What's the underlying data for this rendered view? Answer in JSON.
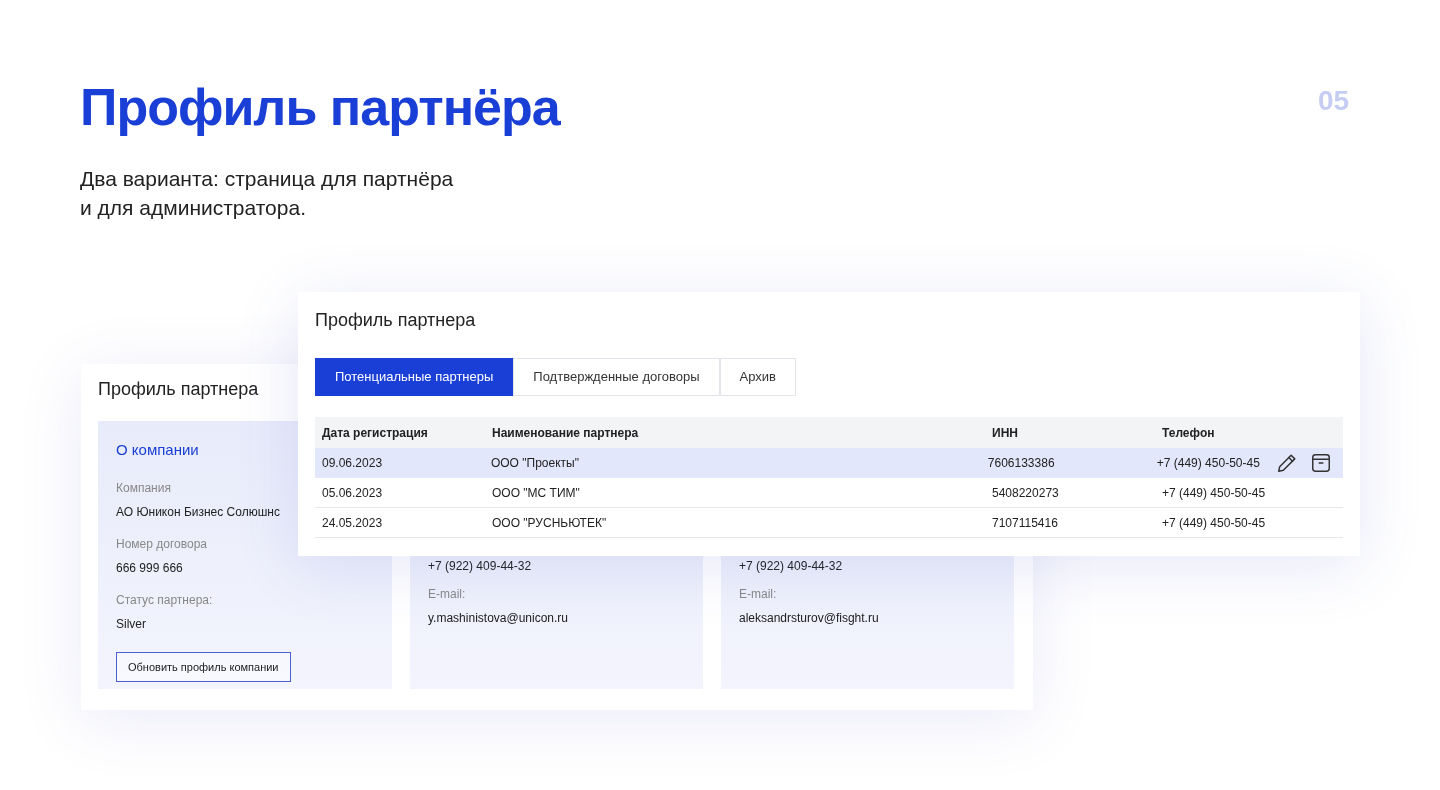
{
  "slide": {
    "title": "Профиль партнёра",
    "subtitle": "Два варианта: страница для партнёра\nи для администратора.",
    "page_number": "05"
  },
  "partner_view": {
    "title": "Профиль партнера",
    "company_panel": {
      "heading": "О компании",
      "fields": [
        {
          "label": "Компания",
          "value": "АО Юникон Бизнес Солюшнс"
        },
        {
          "label": "Номер договора",
          "value": "666 999 666"
        },
        {
          "label": "Статус партнера:",
          "value": "Silver"
        }
      ],
      "button": "Обновить профиль компании"
    },
    "contact_panels": [
      {
        "phone": "+7 (922) 409-44-32",
        "email_label": "E-mail:",
        "email": "y.mashinistova@unicon.ru"
      },
      {
        "phone": "+7 (922) 409-44-32",
        "email_label": "E-mail:",
        "email": "aleksandrsturov@fisght.ru"
      }
    ]
  },
  "admin_view": {
    "title": "Профиль партнера",
    "tabs": [
      {
        "label": "Потенциальные партнеры",
        "selected": true
      },
      {
        "label": "Подтвержденные договоры",
        "selected": false
      },
      {
        "label": "Архив",
        "selected": false
      }
    ],
    "table": {
      "columns": [
        "Дата регистрация",
        "Наименование партнера",
        "ИНН",
        "Телефон"
      ],
      "rows": [
        {
          "selected": true,
          "cells": [
            "09.06.2023",
            "ООО \"Проекты\"",
            "7606133386",
            "+7 (449) 450-50-45"
          ]
        },
        {
          "selected": false,
          "cells": [
            "05.06.2023",
            "ООО \"МС ТИМ\"",
            "5408220273",
            "+7 (449) 450-50-45"
          ]
        },
        {
          "selected": false,
          "cells": [
            "24.05.2023",
            "ООО \"РУСНЬЮТЕК\"",
            "7107115416",
            "+7 (449) 450-50-45"
          ]
        }
      ]
    }
  }
}
